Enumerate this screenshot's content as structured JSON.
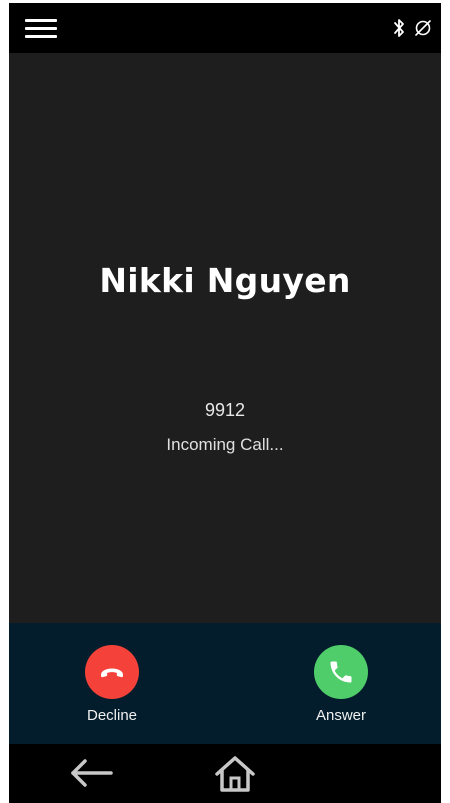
{
  "status_bar": {
    "menu_icon": "hamburger-menu-icon",
    "indicators": [
      "bluetooth-icon",
      "no-connection-icon"
    ]
  },
  "caller": {
    "name": "Nikki Nguyen",
    "number": "9912",
    "status": "Incoming Call..."
  },
  "actions": {
    "decline": {
      "label": "Decline",
      "icon": "hang-up-icon",
      "color": "#f4423a"
    },
    "answer": {
      "label": "Answer",
      "icon": "phone-icon",
      "color": "#4fcd6a"
    }
  },
  "nav_bar": {
    "items": [
      "back-arrow-icon",
      "home-icon"
    ]
  },
  "colors": {
    "background": "#1e1e1e",
    "action_bar": "#041d2c",
    "bars": "#000000"
  }
}
